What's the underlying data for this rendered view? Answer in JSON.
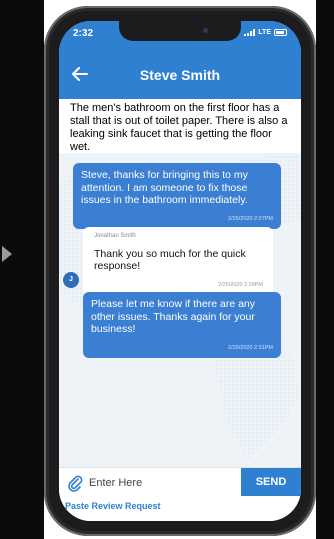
{
  "status_bar": {
    "time": "2:32",
    "network": "LTE"
  },
  "header": {
    "title": "Steve Smith",
    "back_icon": "arrow-left-icon"
  },
  "messages": [
    {
      "direction": "incoming-top",
      "text": "The men's bathroom on the first floor has a stall that is out of toilet paper. There is also a leaking sink faucet that is getting the floor wet."
    },
    {
      "direction": "outgoing",
      "text": "Steve, thanks for bringing this to my attention. I am someone to fix those issues in the bathroom immediately.",
      "time": "2/25/2020 2:27PM"
    },
    {
      "direction": "incoming",
      "sender": "Jonathan Smith",
      "avatar": "J",
      "text": "Thank you so much for the quick response!",
      "time": "2/25/2020 2:28PM"
    },
    {
      "direction": "outgoing",
      "text": "Please let me know if there are any other issues. Thanks again for your business!",
      "time": "2/25/2020 2:31PM"
    }
  ],
  "composer": {
    "placeholder": "Enter Here",
    "send_label": "SEND",
    "attach_icon": "paperclip-icon"
  },
  "footer": {
    "paste_link": "Paste Review Request"
  },
  "colors": {
    "primary": "#2f80d0",
    "bubble_out": "#3b7fd3",
    "background": "#eef3f8"
  }
}
